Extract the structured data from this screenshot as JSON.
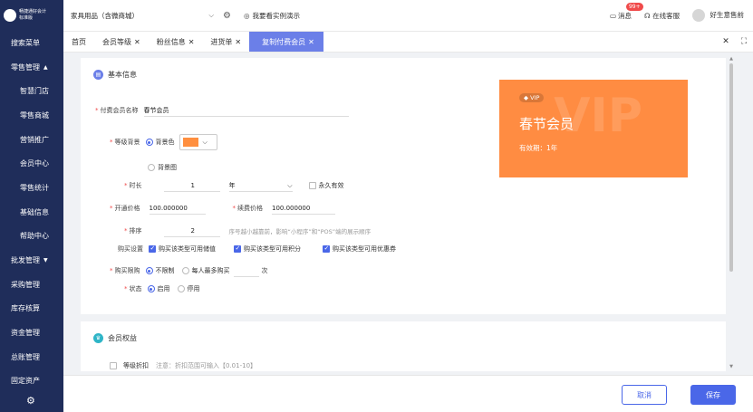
{
  "brand": {
    "name": "畅捷通好会计",
    "edition": "标准版"
  },
  "sidebar": {
    "search": "搜索菜单",
    "retail": "零售管理",
    "retail_items": [
      "智慧门店",
      "零售商城",
      "营销推广",
      "会员中心",
      "零售统计",
      "基础信息",
      "帮助中心"
    ],
    "wholesale": "批发管理",
    "others": [
      "采购管理",
      "库存核算",
      "资金管理",
      "总账管理",
      "固定资产"
    ]
  },
  "topbar": {
    "store": "家具用品（含微商城）",
    "demo": "我要看实例演示",
    "messages": "消息",
    "message_count": "99+",
    "service": "在线客服",
    "user": "好生意售前"
  },
  "tabs": [
    {
      "label": "首页",
      "closable": false
    },
    {
      "label": "会员等级",
      "closable": true
    },
    {
      "label": "粉丝信息",
      "closable": true
    },
    {
      "label": "进货单",
      "closable": true
    },
    {
      "label": "复制付费会员",
      "closable": true,
      "active": true
    }
  ],
  "basic": {
    "title": "基本信息",
    "name_label": "付费会员名称",
    "name_value": "春节会员",
    "bg_label": "等级背景",
    "bg_color": "背景色",
    "bg_image": "背景图",
    "swatch_color": "#ff8f3f",
    "duration_label": "时长",
    "duration_value": "1",
    "duration_unit": "年",
    "forever": "永久有效",
    "open_price_label": "开通价格",
    "open_price": "100.000000",
    "renew_price_label": "续费价格",
    "renew_price": "100.000000",
    "sort_label": "排序",
    "sort_value": "2",
    "sort_hint": "序号越小越靠前，影响“小程序”和“POS”端的展示顺序",
    "purchase_label": "购买设置",
    "purchase_options": [
      "购买该类型可用储值",
      "购买该类型可用积分",
      "购买该类型可用优惠券"
    ],
    "limit_label": "购买限购",
    "limit_none": "不限制",
    "limit_each": "每人最多购买",
    "limit_unit": "次",
    "status_label": "状态",
    "status_on": "启用",
    "status_off": "停用"
  },
  "vip_card": {
    "badge": "VIP",
    "watermark": "VIP",
    "name": "春节会员",
    "validity": "有效期：1年",
    "color": "#ff8c42"
  },
  "rights": {
    "title": "会员权益",
    "discount_label": "等级折扣",
    "discount_hint": "注意：折扣范围可输入【0.01-10】"
  },
  "footer": {
    "cancel": "取消",
    "save": "保存"
  }
}
